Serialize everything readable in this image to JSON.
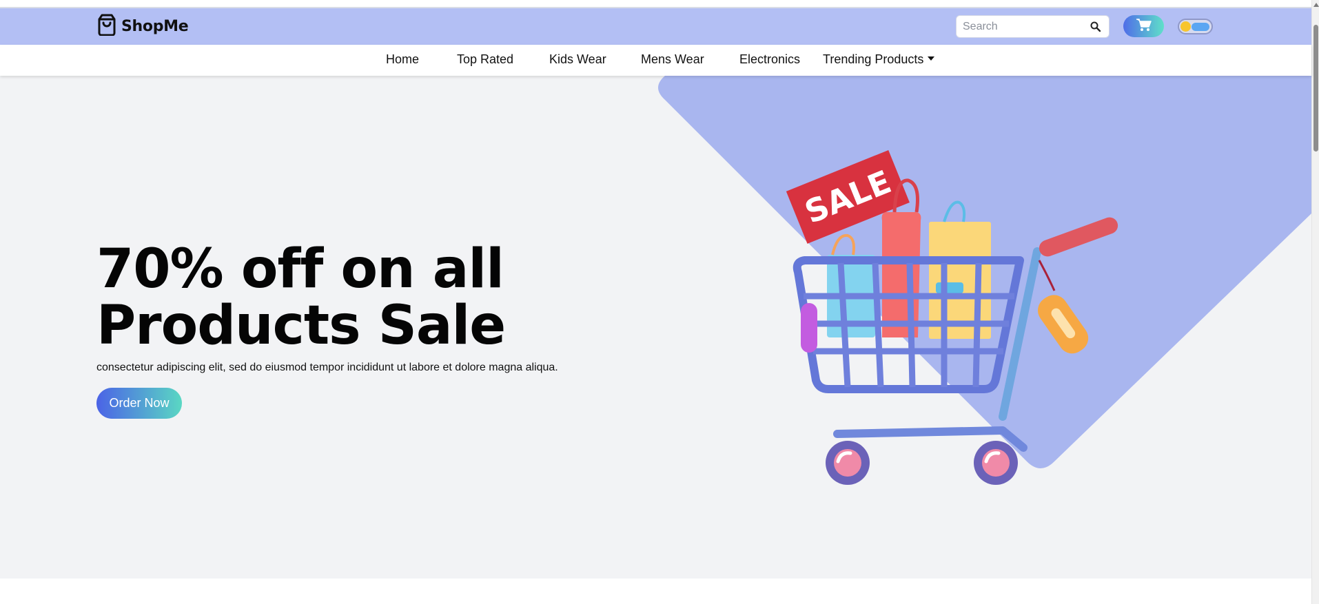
{
  "brand": {
    "name": "ShopMe",
    "logo_icon": "shopping-bag-icon",
    "header_color": "#b3bff4"
  },
  "search": {
    "placeholder": "Search",
    "icon": "search-icon"
  },
  "cart": {
    "icon": "shopping-cart-icon"
  },
  "theme_toggle": {
    "icon": "sun-cloud-toggle-icon",
    "mode": "light"
  },
  "nav": {
    "items": [
      {
        "label": "Home"
      },
      {
        "label": "Top Rated"
      },
      {
        "label": "Kids Wear"
      },
      {
        "label": "Mens Wear"
      },
      {
        "label": "Electronics"
      },
      {
        "label": "Trending Products",
        "has_dropdown": true
      }
    ]
  },
  "hero": {
    "title": "70% off on all Products Sale",
    "subtitle": "consectetur adipiscing elit, sed do eiusmod tempor incididunt ut labore et dolore magna aliqua.",
    "cta_label": "Order Now",
    "sale_tag": "SALE",
    "accent_color": "#a9b6ef"
  }
}
